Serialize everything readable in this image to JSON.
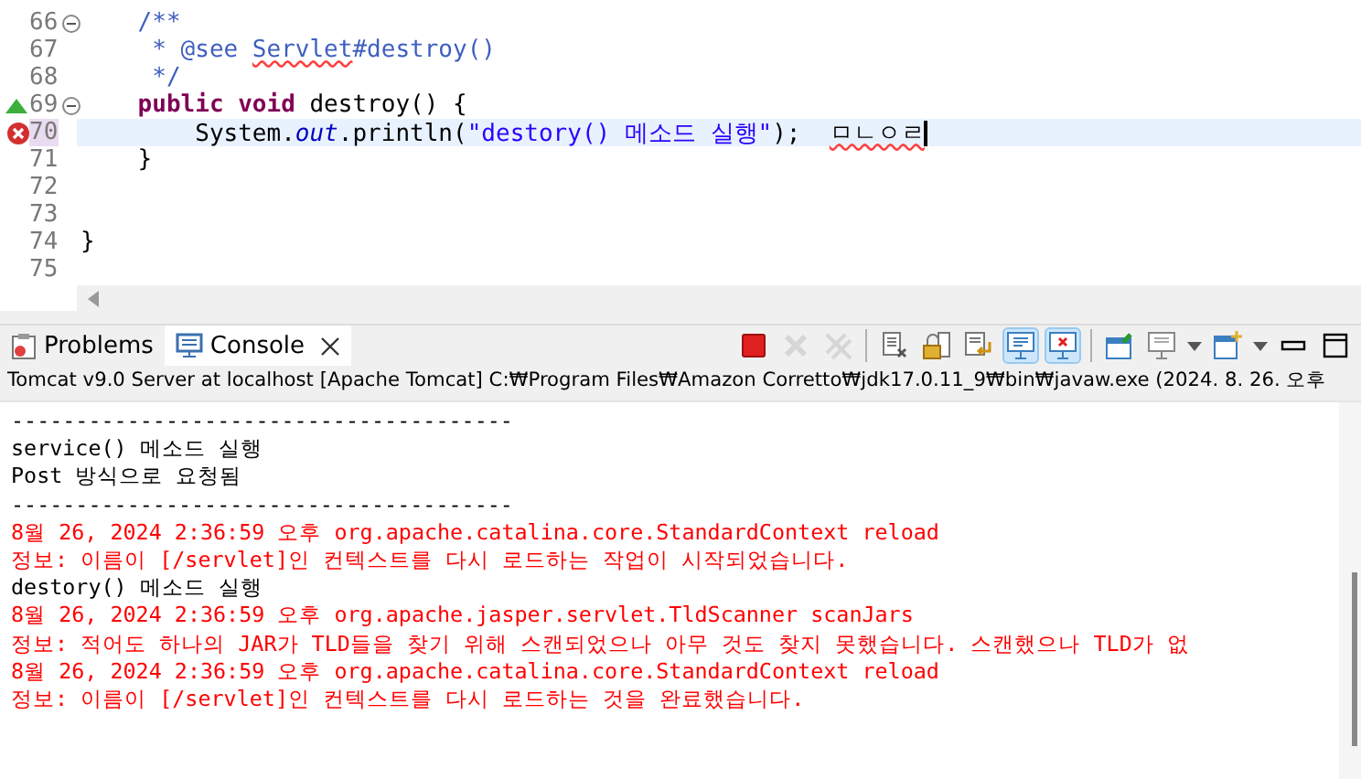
{
  "editor": {
    "lines": [
      {
        "number": "66",
        "foldable": true,
        "overrides": false,
        "error": false,
        "current": false,
        "tokens": [
          {
            "kind": "comment",
            "text": "    /**"
          }
        ]
      },
      {
        "number": "67",
        "foldable": false,
        "overrides": false,
        "error": false,
        "current": false,
        "tokens": [
          {
            "kind": "comment",
            "text": "     * @see "
          },
          {
            "kind": "link",
            "text": "Servlet"
          },
          {
            "kind": "comment",
            "text": "#destroy()"
          }
        ]
      },
      {
        "number": "68",
        "foldable": false,
        "overrides": false,
        "error": false,
        "current": false,
        "tokens": [
          {
            "kind": "comment",
            "text": "     */"
          }
        ]
      },
      {
        "number": "69",
        "foldable": true,
        "overrides": true,
        "error": false,
        "current": false,
        "tokens": [
          {
            "kind": "keyword",
            "text": "    public void"
          },
          {
            "kind": "plain",
            "text": " destroy() {"
          }
        ]
      },
      {
        "number": "70",
        "foldable": false,
        "overrides": false,
        "error": true,
        "current": true,
        "tokens": [
          {
            "kind": "plain",
            "text": "        System."
          },
          {
            "kind": "field",
            "text": "out"
          },
          {
            "kind": "plain",
            "text": ".println("
          },
          {
            "kind": "string",
            "text": "\"destory() 메소드 실행\""
          },
          {
            "kind": "plain",
            "text": ");  "
          },
          {
            "kind": "error",
            "text": "ㅁㄴㅇㄹ"
          }
        ]
      },
      {
        "number": "71",
        "foldable": false,
        "overrides": false,
        "error": false,
        "current": false,
        "tokens": [
          {
            "kind": "plain",
            "text": "    }"
          }
        ]
      },
      {
        "number": "72",
        "foldable": false,
        "overrides": false,
        "error": false,
        "current": false
      },
      {
        "number": "73",
        "foldable": false,
        "overrides": false,
        "error": false,
        "current": false
      },
      {
        "number": "74",
        "foldable": false,
        "overrides": false,
        "error": false,
        "current": false,
        "tokens": [
          {
            "kind": "plain",
            "text": "}"
          }
        ]
      },
      {
        "number": "75",
        "foldable": false,
        "overrides": false,
        "error": false,
        "current": false
      }
    ]
  },
  "views": {
    "tabs": [
      {
        "label": "Problems",
        "selected": false,
        "closable": false
      },
      {
        "label": "Console",
        "selected": true,
        "closable": true
      }
    ],
    "toolbar": [
      [
        {
          "kind": "terminate",
          "disabled": false,
          "pressed": false
        },
        {
          "kind": "remove",
          "disabled": true,
          "pressed": false
        },
        {
          "kind": "remove-all",
          "disabled": true,
          "pressed": false
        }
      ],
      [
        {
          "kind": "clear",
          "disabled": false,
          "pressed": false
        },
        {
          "kind": "scroll-lock",
          "disabled": false,
          "pressed": false
        },
        {
          "kind": "word-wrap",
          "disabled": false,
          "pressed": false
        },
        {
          "kind": "stdout",
          "disabled": false,
          "pressed": true
        },
        {
          "kind": "stderr",
          "disabled": false,
          "pressed": true
        }
      ],
      [
        {
          "kind": "pin",
          "disabled": false,
          "pressed": false
        },
        {
          "kind": "display",
          "disabled": false,
          "pressed": false
        },
        {
          "kind": "dropdown",
          "disabled": false,
          "pressed": false
        },
        {
          "kind": "open",
          "disabled": false,
          "pressed": false
        },
        {
          "kind": "dropdown",
          "disabled": false,
          "pressed": false
        },
        {
          "kind": "minimize",
          "disabled": false,
          "pressed": false
        },
        {
          "kind": "maximize",
          "disabled": false,
          "pressed": false
        }
      ]
    ]
  },
  "console": {
    "description": "Tomcat v9.0 Server at localhost [Apache Tomcat] C:₩Program Files₩Amazon Corretto₩jdk17.0.11_9₩bin₩javaw.exe  (2024. 8. 26. 오후",
    "lines": [
      {
        "kind": "stdout",
        "text": "---------------------------------------"
      },
      {
        "kind": "stdout",
        "text": "service() 메소드 실행"
      },
      {
        "kind": "stdout",
        "text": "Post 방식으로 요청됨"
      },
      {
        "kind": "stdout",
        "text": "---------------------------------------"
      },
      {
        "kind": "stderr",
        "text": "8월 26, 2024 2:36:59 오후 org.apache.catalina.core.StandardContext reload"
      },
      {
        "kind": "stderr",
        "text": "정보: 이름이 [/servlet]인 컨텍스트를 다시 로드하는 작업이 시작되었습니다."
      },
      {
        "kind": "stdout",
        "text": "destory() 메소드 실행"
      },
      {
        "kind": "stderr",
        "text": "8월 26, 2024 2:36:59 오후 org.apache.jasper.servlet.TldScanner scanJars"
      },
      {
        "kind": "stderr",
        "text": "정보: 적어도 하나의 JAR가 TLD들을 찾기 위해 스캔되었으나 아무 것도 찾지 못했습니다. 스캔했으나 TLD가 없"
      },
      {
        "kind": "stderr",
        "text": "8월 26, 2024 2:36:59 오후 org.apache.catalina.core.StandardContext reload"
      },
      {
        "kind": "stderr",
        "text": "정보: 이름이 [/servlet]인 컨텍스트를 다시 로드하는 것을 완료했습니다."
      }
    ]
  }
}
